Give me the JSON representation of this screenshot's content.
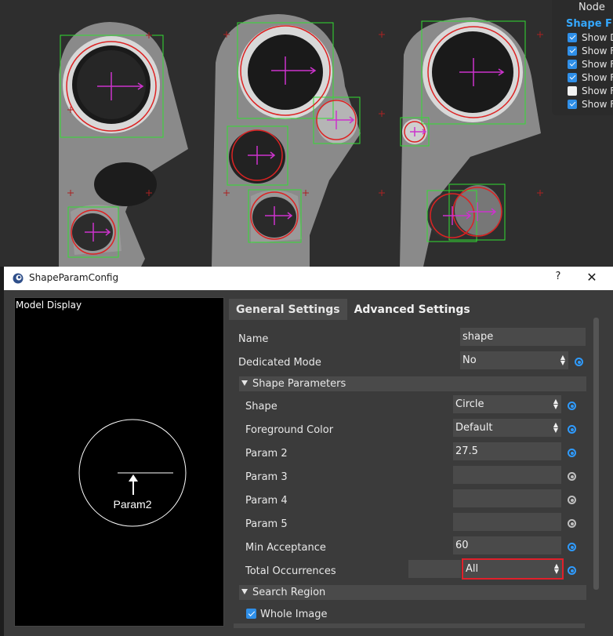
{
  "node_panel": {
    "title": "Node",
    "subtitle": "Shape Fin",
    "items": [
      {
        "label": "Show D",
        "checked": true
      },
      {
        "label": "Show F",
        "checked": true
      },
      {
        "label": "Show F",
        "checked": true
      },
      {
        "label": "Show F",
        "checked": true
      },
      {
        "label": "Show F",
        "checked": false
      },
      {
        "label": "Show F",
        "checked": true
      }
    ]
  },
  "dialog": {
    "title": "ShapeParamConfig",
    "help": "?",
    "close": "✕"
  },
  "model_display": {
    "title": "Model Display",
    "param_label": "Param2"
  },
  "tabs": [
    {
      "label": "General Settings",
      "active": true
    },
    {
      "label": "Advanced Settings",
      "active": false
    }
  ],
  "general": {
    "name": {
      "label": "Name",
      "value": "shape"
    },
    "dedicated_mode": {
      "label": "Dedicated Mode",
      "value": "No"
    },
    "shape_parameters": {
      "title": "Shape Parameters",
      "shape": {
        "label": "Shape",
        "value": "Circle"
      },
      "foreground_color": {
        "label": "Foreground Color",
        "value": "Default"
      },
      "param2": {
        "label": "Param 2",
        "value": "27.5"
      },
      "param3": {
        "label": "Param 3",
        "value": ""
      },
      "param4": {
        "label": "Param 4",
        "value": ""
      },
      "param5": {
        "label": "Param 5",
        "value": ""
      },
      "min_acceptance": {
        "label": "Min Acceptance",
        "value": "60"
      },
      "total_occurrences": {
        "label": "Total Occurrences",
        "count": "",
        "value": "All"
      }
    },
    "search_region": {
      "title": "Search Region",
      "whole_image": {
        "label": "Whole Image",
        "checked": true
      }
    }
  },
  "colors": {
    "accent": "#2f8fe8",
    "highlight": "#e0202a",
    "detection_box": "#33dd33",
    "detection_circle": "#dd2222",
    "center_marker": "#cc33cc"
  }
}
